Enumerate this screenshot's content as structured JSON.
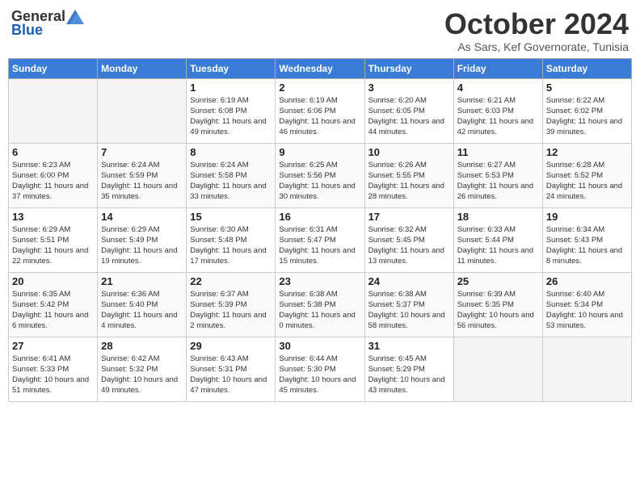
{
  "header": {
    "logo_general": "General",
    "logo_blue": "Blue",
    "month_year": "October 2024",
    "location": "As Sars, Kef Governorate, Tunisia"
  },
  "weekdays": [
    "Sunday",
    "Monday",
    "Tuesday",
    "Wednesday",
    "Thursday",
    "Friday",
    "Saturday"
  ],
  "weeks": [
    [
      {
        "day": "",
        "info": ""
      },
      {
        "day": "",
        "info": ""
      },
      {
        "day": "1",
        "info": "Sunrise: 6:19 AM\nSunset: 6:08 PM\nDaylight: 11 hours and 49 minutes."
      },
      {
        "day": "2",
        "info": "Sunrise: 6:19 AM\nSunset: 6:06 PM\nDaylight: 11 hours and 46 minutes."
      },
      {
        "day": "3",
        "info": "Sunrise: 6:20 AM\nSunset: 6:05 PM\nDaylight: 11 hours and 44 minutes."
      },
      {
        "day": "4",
        "info": "Sunrise: 6:21 AM\nSunset: 6:03 PM\nDaylight: 11 hours and 42 minutes."
      },
      {
        "day": "5",
        "info": "Sunrise: 6:22 AM\nSunset: 6:02 PM\nDaylight: 11 hours and 39 minutes."
      }
    ],
    [
      {
        "day": "6",
        "info": "Sunrise: 6:23 AM\nSunset: 6:00 PM\nDaylight: 11 hours and 37 minutes."
      },
      {
        "day": "7",
        "info": "Sunrise: 6:24 AM\nSunset: 5:59 PM\nDaylight: 11 hours and 35 minutes."
      },
      {
        "day": "8",
        "info": "Sunrise: 6:24 AM\nSunset: 5:58 PM\nDaylight: 11 hours and 33 minutes."
      },
      {
        "day": "9",
        "info": "Sunrise: 6:25 AM\nSunset: 5:56 PM\nDaylight: 11 hours and 30 minutes."
      },
      {
        "day": "10",
        "info": "Sunrise: 6:26 AM\nSunset: 5:55 PM\nDaylight: 11 hours and 28 minutes."
      },
      {
        "day": "11",
        "info": "Sunrise: 6:27 AM\nSunset: 5:53 PM\nDaylight: 11 hours and 26 minutes."
      },
      {
        "day": "12",
        "info": "Sunrise: 6:28 AM\nSunset: 5:52 PM\nDaylight: 11 hours and 24 minutes."
      }
    ],
    [
      {
        "day": "13",
        "info": "Sunrise: 6:29 AM\nSunset: 5:51 PM\nDaylight: 11 hours and 22 minutes."
      },
      {
        "day": "14",
        "info": "Sunrise: 6:29 AM\nSunset: 5:49 PM\nDaylight: 11 hours and 19 minutes."
      },
      {
        "day": "15",
        "info": "Sunrise: 6:30 AM\nSunset: 5:48 PM\nDaylight: 11 hours and 17 minutes."
      },
      {
        "day": "16",
        "info": "Sunrise: 6:31 AM\nSunset: 5:47 PM\nDaylight: 11 hours and 15 minutes."
      },
      {
        "day": "17",
        "info": "Sunrise: 6:32 AM\nSunset: 5:45 PM\nDaylight: 11 hours and 13 minutes."
      },
      {
        "day": "18",
        "info": "Sunrise: 6:33 AM\nSunset: 5:44 PM\nDaylight: 11 hours and 11 minutes."
      },
      {
        "day": "19",
        "info": "Sunrise: 6:34 AM\nSunset: 5:43 PM\nDaylight: 11 hours and 8 minutes."
      }
    ],
    [
      {
        "day": "20",
        "info": "Sunrise: 6:35 AM\nSunset: 5:42 PM\nDaylight: 11 hours and 6 minutes."
      },
      {
        "day": "21",
        "info": "Sunrise: 6:36 AM\nSunset: 5:40 PM\nDaylight: 11 hours and 4 minutes."
      },
      {
        "day": "22",
        "info": "Sunrise: 6:37 AM\nSunset: 5:39 PM\nDaylight: 11 hours and 2 minutes."
      },
      {
        "day": "23",
        "info": "Sunrise: 6:38 AM\nSunset: 5:38 PM\nDaylight: 11 hours and 0 minutes."
      },
      {
        "day": "24",
        "info": "Sunrise: 6:38 AM\nSunset: 5:37 PM\nDaylight: 10 hours and 58 minutes."
      },
      {
        "day": "25",
        "info": "Sunrise: 6:39 AM\nSunset: 5:35 PM\nDaylight: 10 hours and 56 minutes."
      },
      {
        "day": "26",
        "info": "Sunrise: 6:40 AM\nSunset: 5:34 PM\nDaylight: 10 hours and 53 minutes."
      }
    ],
    [
      {
        "day": "27",
        "info": "Sunrise: 6:41 AM\nSunset: 5:33 PM\nDaylight: 10 hours and 51 minutes."
      },
      {
        "day": "28",
        "info": "Sunrise: 6:42 AM\nSunset: 5:32 PM\nDaylight: 10 hours and 49 minutes."
      },
      {
        "day": "29",
        "info": "Sunrise: 6:43 AM\nSunset: 5:31 PM\nDaylight: 10 hours and 47 minutes."
      },
      {
        "day": "30",
        "info": "Sunrise: 6:44 AM\nSunset: 5:30 PM\nDaylight: 10 hours and 45 minutes."
      },
      {
        "day": "31",
        "info": "Sunrise: 6:45 AM\nSunset: 5:29 PM\nDaylight: 10 hours and 43 minutes."
      },
      {
        "day": "",
        "info": ""
      },
      {
        "day": "",
        "info": ""
      }
    ]
  ]
}
